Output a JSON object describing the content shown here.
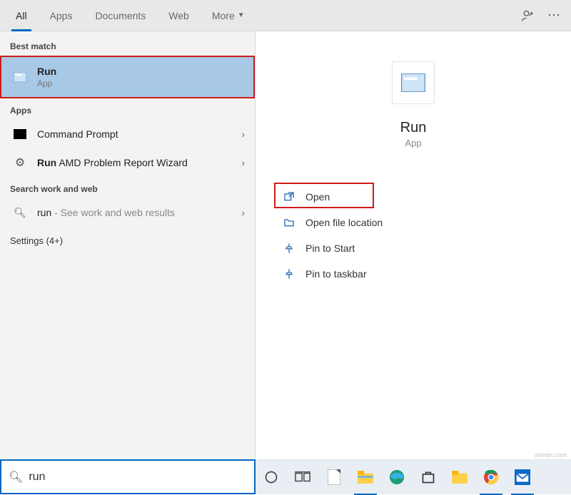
{
  "tabs": {
    "all": "All",
    "apps": "Apps",
    "documents": "Documents",
    "web": "Web",
    "more": "More"
  },
  "sections": {
    "best_match": "Best match",
    "apps": "Apps",
    "search_web": "Search work and web"
  },
  "best_match": {
    "title": "Run",
    "subtitle": "App"
  },
  "apps_list": {
    "cmd": {
      "label": "Command Prompt"
    },
    "amd": {
      "prefix": "Run",
      "rest": " AMD Problem Report Wizard"
    }
  },
  "web_result": {
    "term": "run",
    "hint": " - See work and web results"
  },
  "settings_link": "Settings (4+)",
  "detail": {
    "title": "Run",
    "subtitle": "App"
  },
  "actions": {
    "open": "Open",
    "open_loc": "Open file location",
    "pin_start": "Pin to Start",
    "pin_taskbar": "Pin to taskbar"
  },
  "search": {
    "value": "run"
  },
  "watermark": "wsxdn.com"
}
